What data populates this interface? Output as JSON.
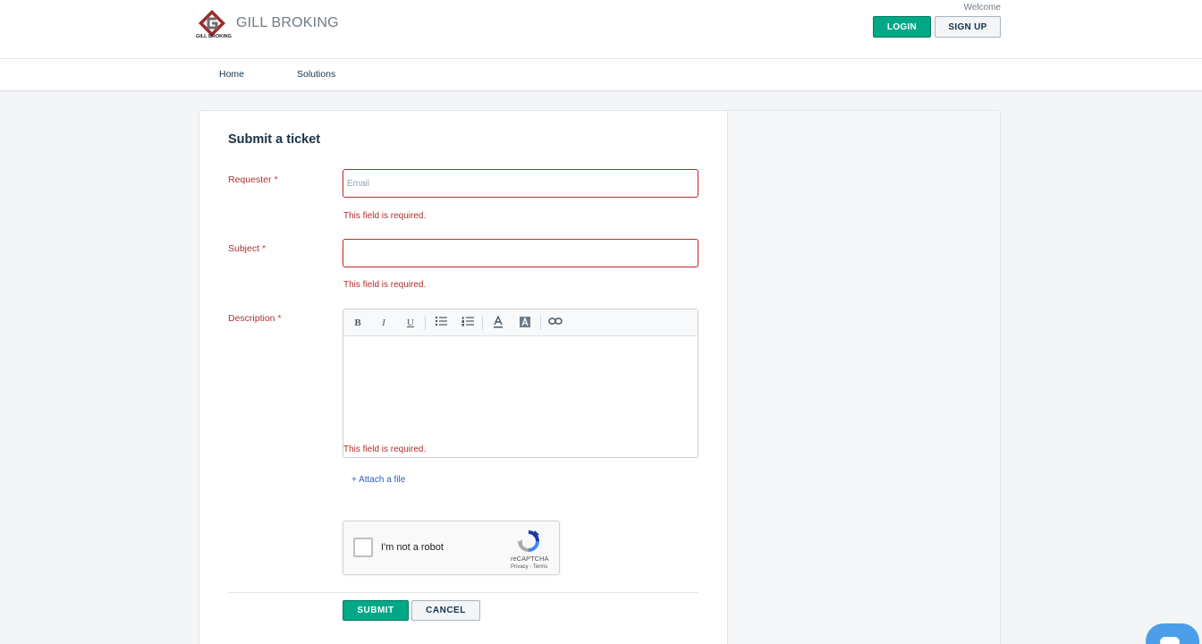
{
  "header": {
    "brand_name": "GILL BROKING",
    "logo_caption": "GILL BROKING",
    "welcome": "Welcome",
    "login_label": "LOGIN",
    "signup_label": "SIGN UP"
  },
  "nav": {
    "items": [
      {
        "label": "Home"
      },
      {
        "label": "Solutions"
      }
    ]
  },
  "form": {
    "title": "Submit a ticket",
    "requester": {
      "label": "Requester",
      "required_mark": "*",
      "placeholder": "Email",
      "value": "",
      "error": "This field is required."
    },
    "subject": {
      "label": "Subject",
      "required_mark": "*",
      "value": "",
      "error": "This field is required."
    },
    "description": {
      "label": "Description",
      "required_mark": "*",
      "error": "This field is required.",
      "toolbar": {
        "bold": "B",
        "italic": "I",
        "underline": "U"
      }
    },
    "attach_label": "+ Attach a file",
    "captcha": {
      "text": "I'm not a robot",
      "brand": "reCAPTCHA",
      "links": "Privacy - Terms"
    },
    "submit_label": "SUBMIT",
    "cancel_label": "CANCEL"
  },
  "colors": {
    "primary_green": "#00a886",
    "error_red": "#c0252b",
    "link_blue": "#2c5cc5",
    "chat_blue": "#4d9ee8"
  }
}
